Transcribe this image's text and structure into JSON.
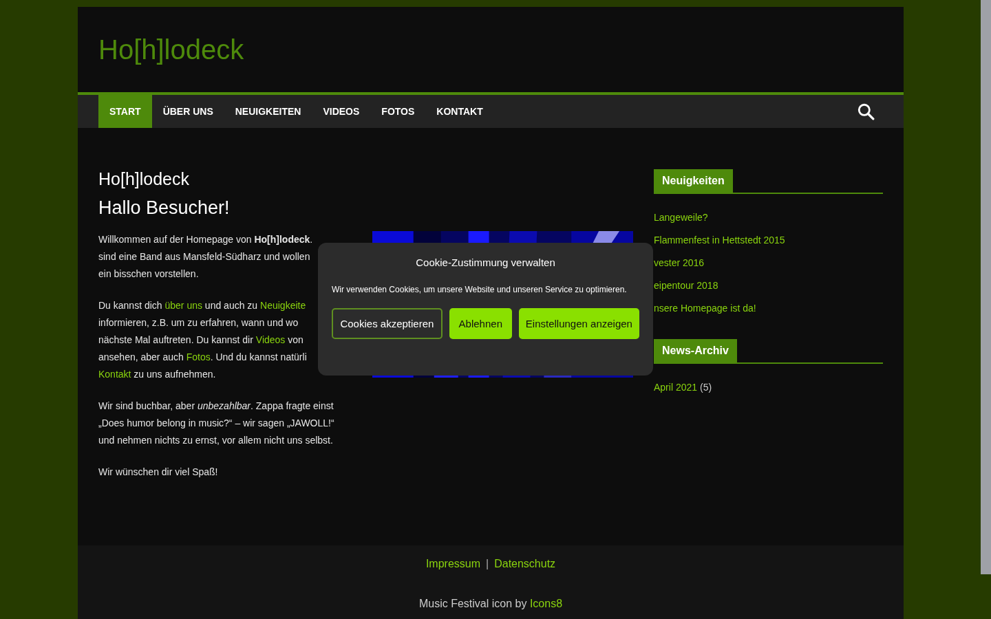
{
  "site_title": "Ho[h]lodeck",
  "nav": [
    {
      "label": "START",
      "selected": true
    },
    {
      "label": "ÜBER UNS",
      "selected": false
    },
    {
      "label": "NEUIGKEITEN",
      "selected": false
    },
    {
      "label": "VIDEOS",
      "selected": false
    },
    {
      "label": "FOTOS",
      "selected": false
    },
    {
      "label": "KONTAKT",
      "selected": false
    }
  ],
  "page": {
    "title": "Ho[h]lodeck",
    "heading": "Hallo Besucher!",
    "paragraphs": [
      [
        [
          {
            "text": "Willkommen auf der Homepage von **Ho[h]lodeck**."
          }
        ],
        [
          {
            "text": "sind eine Band aus Mansfeld-Südharz und wollen"
          }
        ],
        [
          {
            "text": "ein bisschen vorstellen."
          }
        ]
      ],
      [
        [
          {
            "text": "Du kannst dich "
          },
          {
            "text": "über uns",
            "link": true
          },
          {
            "text": " und auch zu "
          },
          {
            "text": "Neuigkeite",
            "link": true
          }
        ],
        [
          {
            "text": "informieren, z.B. um zu erfahren, wann und wo"
          }
        ],
        [
          {
            "text": "nächste Mal auftreten. Du kannst dir "
          },
          {
            "text": "Videos",
            "link": true
          },
          {
            "text": " von"
          }
        ],
        [
          {
            "text": "ansehen, aber auch "
          },
          {
            "text": "Fotos",
            "link": true
          },
          {
            "text": ". Und du kannst natürli"
          }
        ],
        [
          {
            "text": "Kontakt",
            "link": true
          },
          {
            "text": " zu uns aufnehmen."
          }
        ]
      ],
      [
        [
          {
            "text": "Wir sind buchbar, aber *unbezahlbar*. Zappa fragte einst"
          }
        ],
        [
          {
            "text": "„Does humor belong in music?“ – wir sagen „JAWOLL!“"
          }
        ],
        [
          {
            "text": "und nehmen nichts zu ernst, vor allem nicht uns selbst."
          }
        ]
      ],
      [
        [
          {
            "text": "Wir wünschen dir viel Spaß!"
          }
        ]
      ]
    ],
    "image": {
      "kind": "picture"
    }
  },
  "sidebar": [
    {
      "title": "Neuigkeiten",
      "items": [
        {
          "text": "Langeweile?"
        },
        {
          "text": "Flammenfest in Hettstedt 2015"
        },
        {
          "text": "vester 2016"
        },
        {
          "text": "eipentour 2018"
        },
        {
          "text": "nsere Homepage ist da!"
        }
      ]
    },
    {
      "title": "News-Archiv",
      "items": [
        {
          "text": "April 2021",
          "count": "(5)"
        }
      ]
    }
  ],
  "footer": {
    "links": [
      "Impressum",
      "Datenschutz"
    ],
    "separator": "|",
    "credit": "Music Festival icon by",
    "credit_link": "Icons8"
  },
  "cookie_dialog": {
    "title": "Cookie-Zustimmung verwalten",
    "text": "Wir verwenden Cookies, um unsere Website und unseren Service zu optimieren.",
    "buttons": [
      {
        "label": "Cookies akzeptieren",
        "kind": "outline"
      },
      {
        "label": "Ablehnen",
        "kind": "filled"
      },
      {
        "label": "Einstellungen anzeigen",
        "kind": "filled"
      }
    ]
  }
}
